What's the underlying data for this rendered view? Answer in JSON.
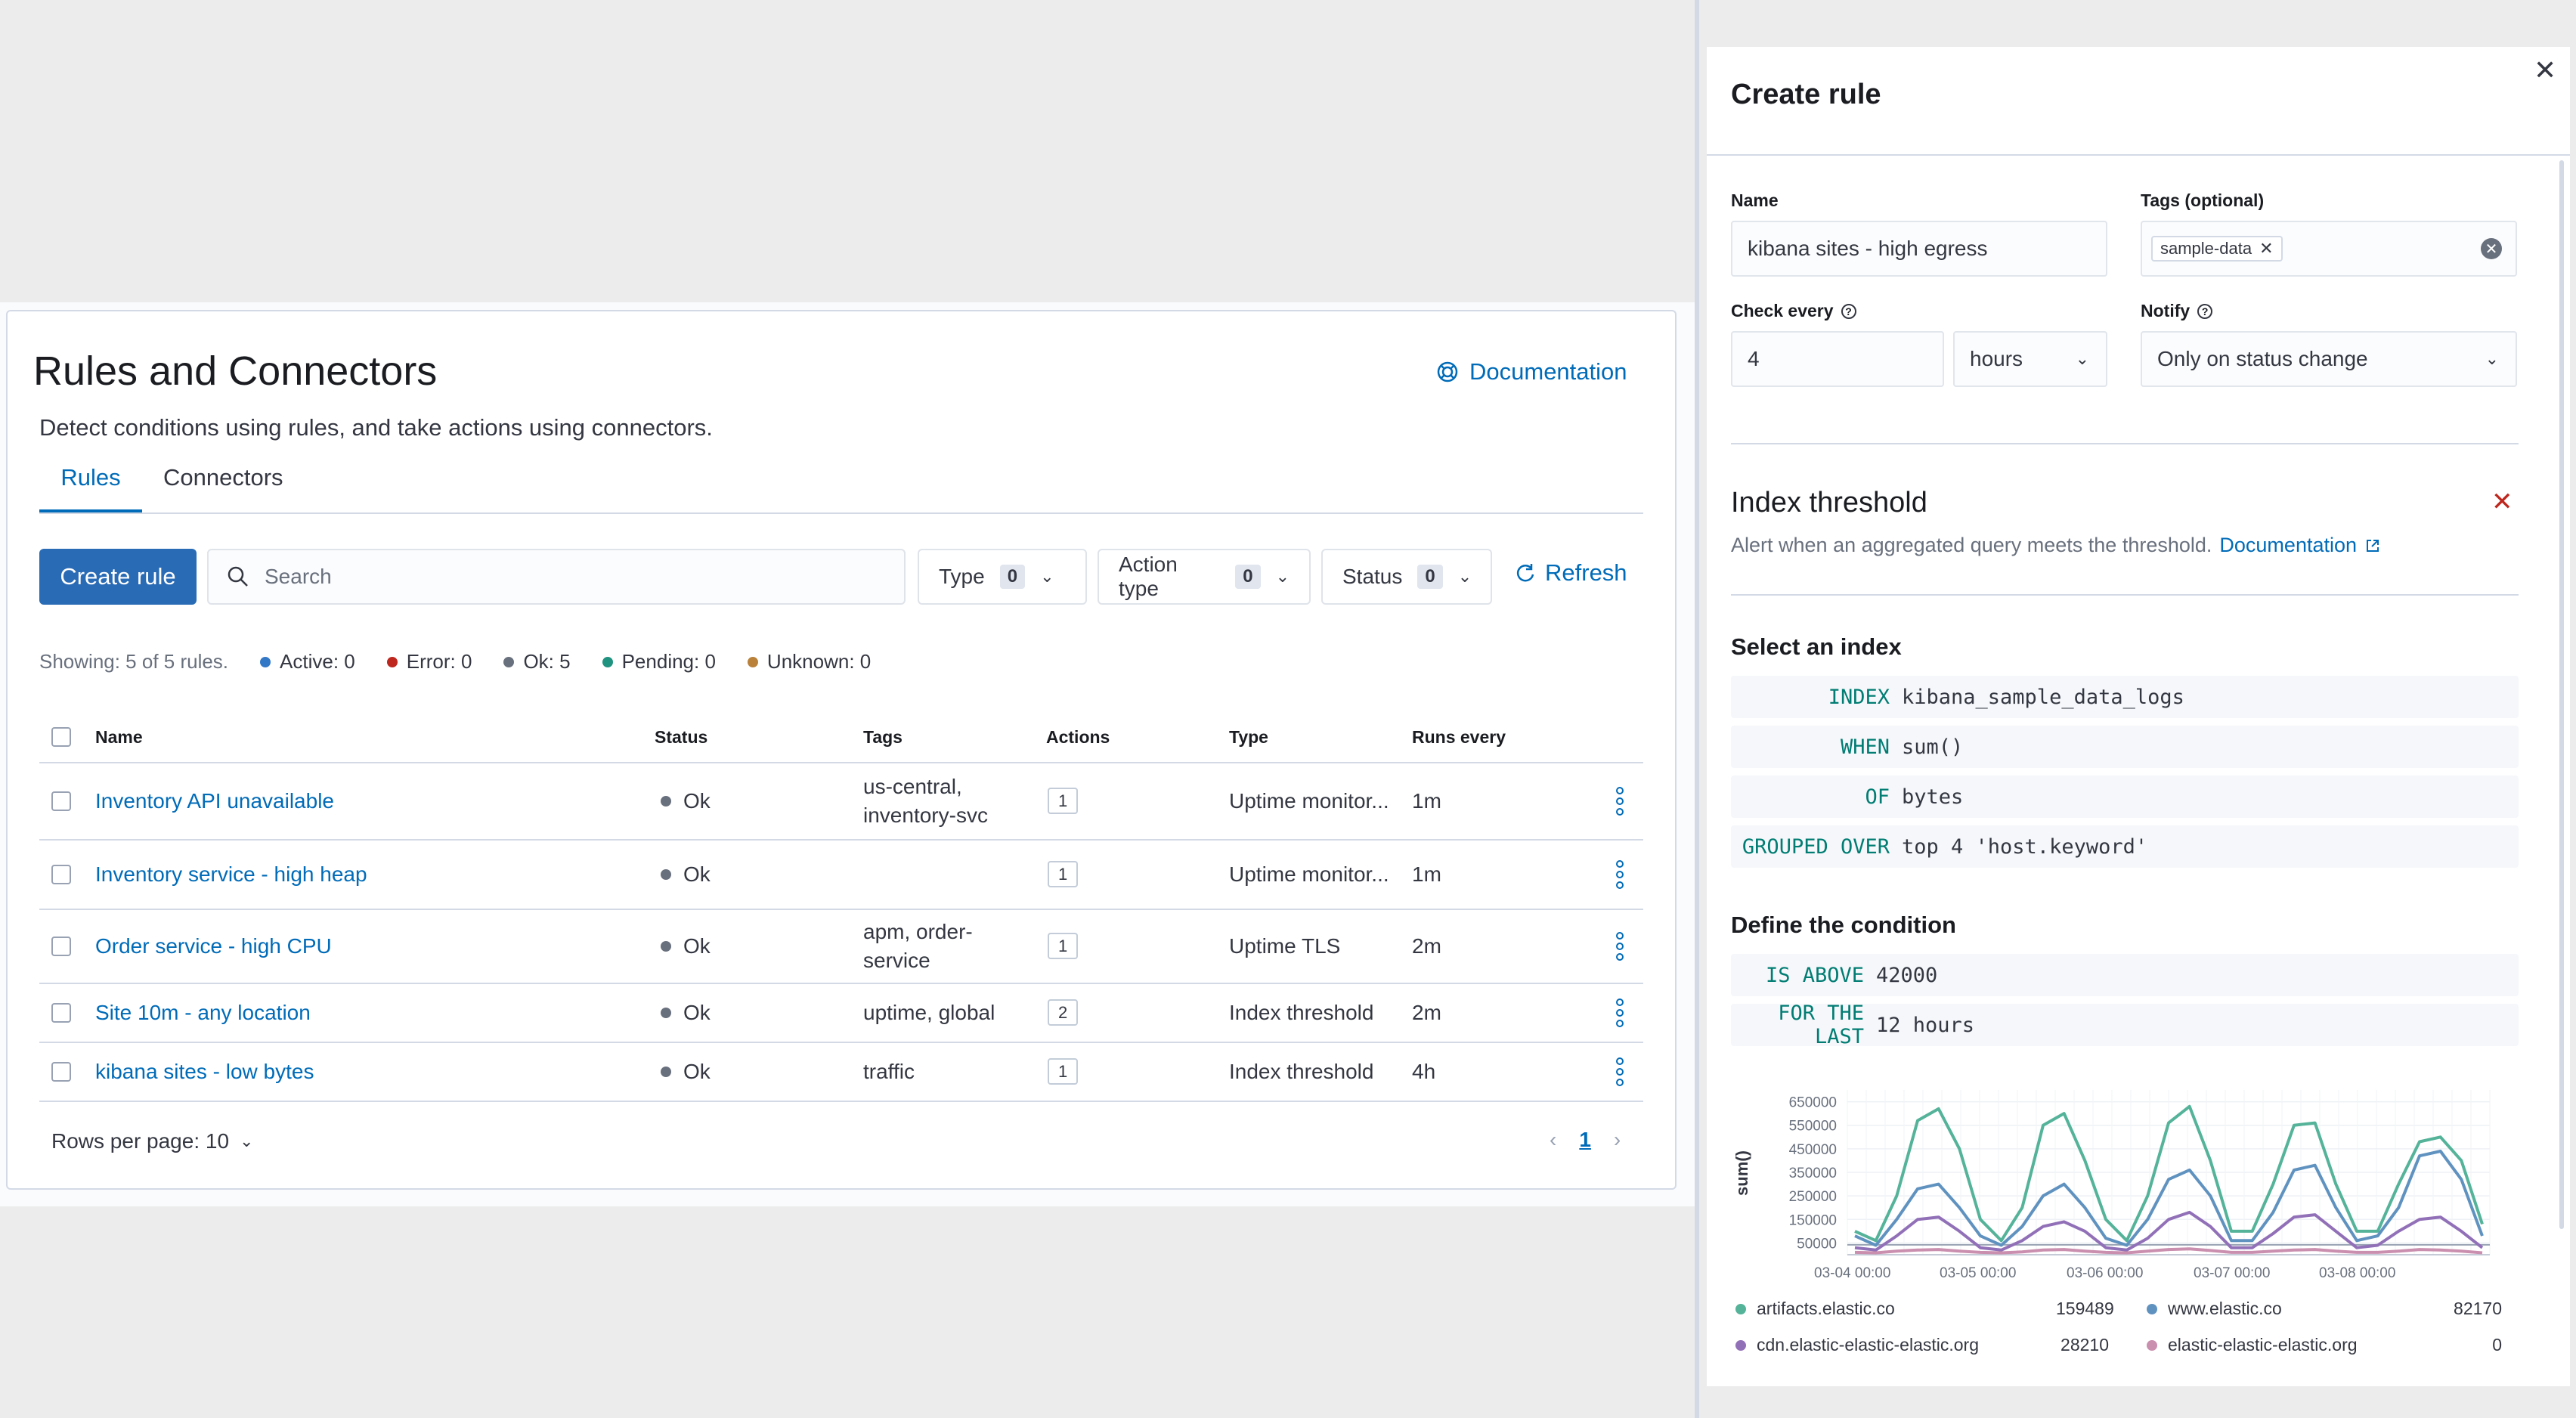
{
  "rules_page": {
    "title": "Rules and Connectors",
    "description": "Detect conditions using rules, and take actions using connectors.",
    "documentation_link": "Documentation",
    "tabs": [
      {
        "label": "Rules"
      },
      {
        "label": "Connectors"
      }
    ],
    "create_button": "Create rule",
    "search_placeholder": "Search",
    "filters": [
      {
        "label": "Type",
        "count": "0"
      },
      {
        "label": "Action type",
        "count": "0"
      },
      {
        "label": "Status",
        "count": "0"
      }
    ],
    "refresh_label": "Refresh",
    "summary": {
      "showing": "Showing: 5 of 5 rules.",
      "stats": [
        {
          "label": "Active: 0",
          "color": "#3378c6"
        },
        {
          "label": "Error: 0",
          "color": "#bd271e"
        },
        {
          "label": "Ok: 5",
          "color": "#69707d"
        },
        {
          "label": "Pending: 0",
          "color": "#209280"
        },
        {
          "label": "Unknown: 0",
          "color": "#b9813a"
        }
      ]
    },
    "table": {
      "headers": [
        "Name",
        "Status",
        "Tags",
        "Actions",
        "Type",
        "Runs every"
      ],
      "rows": [
        {
          "name": "Inventory API unavailable",
          "status": "Ok",
          "tags": "us-central, inventory-svc",
          "actions": "1",
          "type": "Uptime monitor...",
          "runs": "1m"
        },
        {
          "name": "Inventory service - high heap",
          "status": "Ok",
          "tags": "",
          "actions": "1",
          "type": "Uptime monitor...",
          "runs": "1m"
        },
        {
          "name": "Order service - high CPU",
          "status": "Ok",
          "tags": "apm, order-service",
          "actions": "1",
          "type": "Uptime TLS",
          "runs": "2m"
        },
        {
          "name": "Site 10m - any location",
          "status": "Ok",
          "tags": "uptime, global",
          "actions": "2",
          "type": "Index threshold",
          "runs": "2m"
        },
        {
          "name": "kibana sites - low bytes",
          "status": "Ok",
          "tags": "traffic",
          "actions": "1",
          "type": "Index threshold",
          "runs": "4h"
        }
      ]
    },
    "rows_per_page": "Rows per page: 10",
    "current_page": "1"
  },
  "flyout": {
    "title": "Create rule",
    "name_label": "Name",
    "name_value": "kibana sites - high egress",
    "tags_label": "Tags (optional)",
    "tag_chip": "sample-data",
    "check_every_label": "Check every",
    "check_every_value": "4",
    "check_every_unit": "hours",
    "notify_label": "Notify",
    "notify_value": "Only on status change",
    "rule_type_title": "Index threshold",
    "rule_type_desc": "Alert when an aggregated query meets the threshold.",
    "rule_type_doc_link": "Documentation",
    "select_index_title": "Select an index",
    "index_expressions": [
      {
        "keyword": "INDEX",
        "value": "kibana_sample_data_logs"
      },
      {
        "keyword": "WHEN",
        "value": "sum()"
      },
      {
        "keyword": "OF",
        "value": "bytes"
      },
      {
        "keyword": "GROUPED OVER",
        "value": "top 4 'host.keyword'"
      }
    ],
    "condition_title": "Define the condition",
    "condition_expressions": [
      {
        "keyword": "IS ABOVE",
        "value": "42000"
      },
      {
        "keyword": "FOR THE LAST",
        "value": "12 hours"
      }
    ],
    "legend": [
      {
        "name": "artifacts.elastic.co",
        "value": "159489",
        "color": "#54b399"
      },
      {
        "name": "www.elastic.co",
        "value": "82170",
        "color": "#6092c0"
      },
      {
        "name": "cdn.elastic-elastic-elastic.org",
        "value": "28210",
        "color": "#9170b8"
      },
      {
        "name": "elastic-elastic-elastic.org",
        "value": "0",
        "color": "#ca8eae"
      }
    ]
  },
  "chart_data": {
    "type": "line",
    "ylabel": "sum()",
    "yticks": [
      "650000",
      "550000",
      "450000",
      "350000",
      "250000",
      "150000",
      "50000"
    ],
    "xticks": [
      "03-04 00:00",
      "03-05 00:00",
      "03-06 00:00",
      "03-07 00:00",
      "03-08 00:00"
    ],
    "ylim": [
      0,
      700000
    ],
    "threshold": 42000,
    "series": [
      {
        "name": "artifacts.elastic.co",
        "color": "#54b399",
        "values": [
          100000,
          60000,
          250000,
          570000,
          620000,
          450000,
          150000,
          60000,
          200000,
          550000,
          600000,
          400000,
          150000,
          60000,
          250000,
          560000,
          630000,
          400000,
          100000,
          100000,
          300000,
          550000,
          560000,
          300000,
          100000,
          100000,
          300000,
          480000,
          500000,
          400000,
          130000
        ]
      },
      {
        "name": "www.elastic.co",
        "color": "#6092c0",
        "values": [
          80000,
          40000,
          150000,
          280000,
          300000,
          200000,
          80000,
          40000,
          120000,
          250000,
          300000,
          200000,
          70000,
          40000,
          150000,
          320000,
          360000,
          250000,
          60000,
          60000,
          180000,
          360000,
          380000,
          200000,
          60000,
          80000,
          200000,
          420000,
          440000,
          320000,
          80000
        ]
      },
      {
        "name": "cdn.elastic-elastic-elastic.org",
        "color": "#9170b8",
        "values": [
          30000,
          20000,
          80000,
          150000,
          160000,
          100000,
          30000,
          20000,
          60000,
          120000,
          140000,
          100000,
          30000,
          20000,
          70000,
          150000,
          180000,
          120000,
          30000,
          30000,
          90000,
          160000,
          170000,
          100000,
          30000,
          40000,
          100000,
          150000,
          160000,
          100000,
          30000
        ]
      },
      {
        "name": "elastic-elastic-elastic.org",
        "color": "#ca8eae",
        "values": [
          10000,
          8000,
          15000,
          20000,
          22000,
          15000,
          10000,
          8000,
          12000,
          20000,
          22000,
          15000,
          10000,
          8000,
          15000,
          22000,
          25000,
          18000,
          10000,
          10000,
          15000,
          20000,
          22000,
          15000,
          10000,
          10000,
          15000,
          22000,
          20000,
          15000,
          8000
        ]
      }
    ]
  }
}
